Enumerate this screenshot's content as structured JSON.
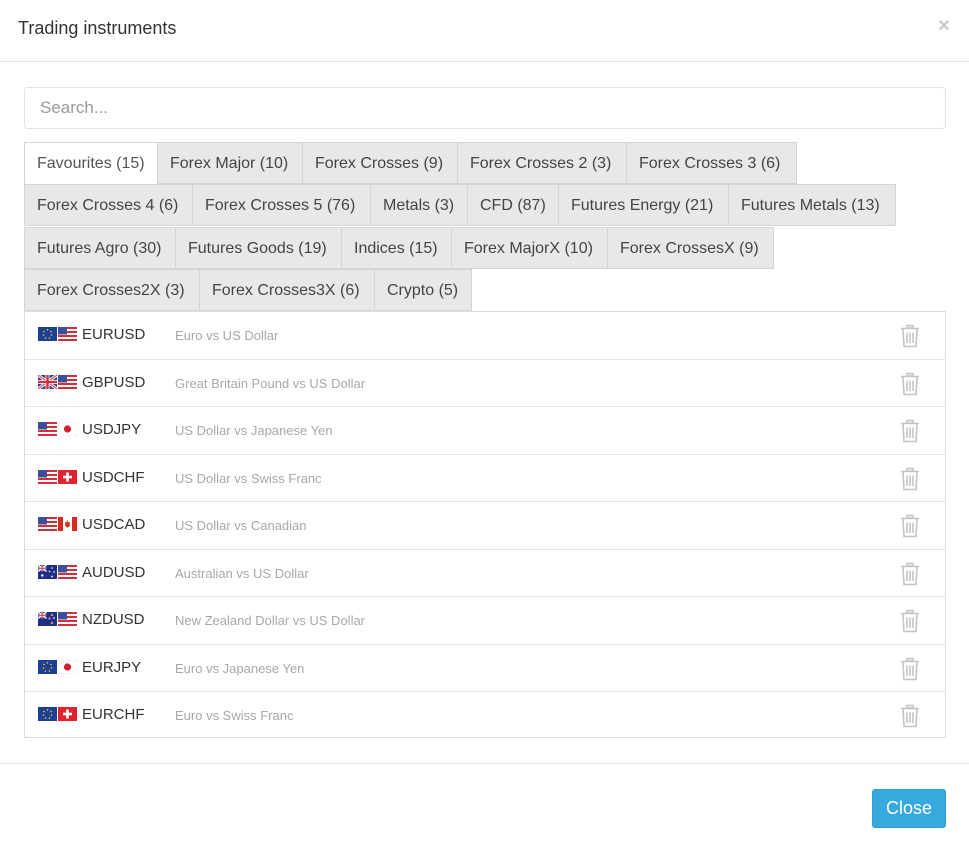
{
  "header": {
    "title": "Trading instruments",
    "close_glyph": "×"
  },
  "search": {
    "placeholder": "Search...",
    "value": ""
  },
  "tabs": [
    {
      "label": "Favourites (15)",
      "active": true
    },
    {
      "label": "Forex Major (10)"
    },
    {
      "label": "Forex Crosses (9)"
    },
    {
      "label": "Forex Crosses 2 (3)"
    },
    {
      "label": "Forex Crosses 3 (6)"
    },
    {
      "label": "Forex Crosses 4 (6)"
    },
    {
      "label": "Forex Crosses 5 (76)"
    },
    {
      "label": "Metals (3)"
    },
    {
      "label": "CFD (87)"
    },
    {
      "label": "Futures Energy (21)"
    },
    {
      "label": "Futures Metals (13)"
    },
    {
      "label": "Futures Agro (30)"
    },
    {
      "label": "Futures Goods (19)"
    },
    {
      "label": "Indices (15)"
    },
    {
      "label": "Forex MajorX (10)"
    },
    {
      "label": "Forex CrossesX (9)"
    },
    {
      "label": "Forex Crosses2X (3)"
    },
    {
      "label": "Forex Crosses3X (6)"
    },
    {
      "label": "Crypto (5)"
    }
  ],
  "instruments": [
    {
      "symbol": "EURUSD",
      "description": "Euro vs US Dollar",
      "flags": [
        "eu-flag",
        "us-flag"
      ]
    },
    {
      "symbol": "GBPUSD",
      "description": "Great Britain Pound vs US Dollar",
      "flags": [
        "gb-flag",
        "us-flag"
      ]
    },
    {
      "symbol": "USDJPY",
      "description": "US Dollar vs Japanese Yen",
      "flags": [
        "us-flag",
        "jp-flag"
      ]
    },
    {
      "symbol": "USDCHF",
      "description": "US Dollar vs Swiss Franc",
      "flags": [
        "us-flag",
        "ch-flag"
      ]
    },
    {
      "symbol": "USDCAD",
      "description": "US Dollar vs Canadian",
      "flags": [
        "us-flag",
        "ca-flag"
      ]
    },
    {
      "symbol": "AUDUSD",
      "description": "Australian vs US Dollar",
      "flags": [
        "au-flag",
        "us-flag"
      ]
    },
    {
      "symbol": "NZDUSD",
      "description": "New Zealand Dollar vs US Dollar",
      "flags": [
        "nz-flag",
        "us-flag"
      ]
    },
    {
      "symbol": "EURJPY",
      "description": "Euro vs Japanese Yen",
      "flags": [
        "eu-flag",
        "jp-flag"
      ]
    },
    {
      "symbol": "EURCHF",
      "description": "Euro vs Swiss Franc",
      "flags": [
        "eu-flag",
        "ch-flag"
      ]
    }
  ],
  "row_action_icon": "trash-icon",
  "footer": {
    "close_label": "Close"
  },
  "colors": {
    "primary_button": "#38a9de",
    "tab_inactive_bg": "#e8e8e8",
    "description_text": "#a8a8a8",
    "trash_icon": "#c4c4c4"
  }
}
